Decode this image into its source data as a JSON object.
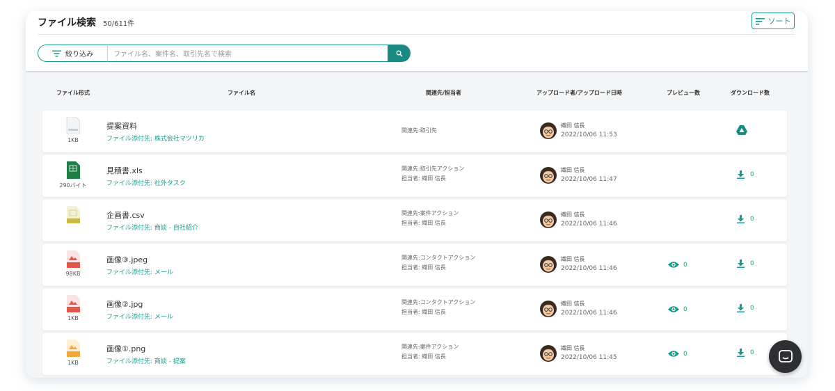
{
  "header": {
    "title": "ファイル検索",
    "count": "50/611件",
    "sort_label": "ソート"
  },
  "search": {
    "filter_label": "絞り込み",
    "placeholder": "ファイル名、案件名、取引先名で検索"
  },
  "columns": {
    "type": "ファイル形式",
    "name": "ファイル名",
    "related": "関連先/担当者",
    "uploader": "アップロード者/アップロード日時",
    "preview": "プレビュー数",
    "download": "ダウンロード数"
  },
  "colors": {
    "accent": "#1a9a8c",
    "xls": "#1e7e45",
    "csv": "#c9b94a",
    "jpeg": "#e2564a",
    "png": "#f2a93b"
  },
  "rows": [
    {
      "icon": "document-icon",
      "size": "1KB",
      "name": "提案資料",
      "attach": "ファイル添付先: 株式会社マツリカ",
      "related": "関連先:取引先",
      "assignee": "",
      "uploader": "織田 信長",
      "date": "2022/10/06 11:53",
      "preview": "",
      "download": "",
      "download_icon": "google-drive-icon"
    },
    {
      "icon": "xls-file-icon",
      "size": "290バイト",
      "name": "見積書.xls",
      "attach": "ファイル添付先: 社外タスク",
      "related": "関連先:取引先アクション",
      "assignee": "担当者: 織田 信長",
      "uploader": "織田 信長",
      "date": "2022/10/06 11:47",
      "preview": "",
      "download": "0",
      "download_icon": "download-icon"
    },
    {
      "icon": "csv-file-icon",
      "size": "",
      "name": "企画書.csv",
      "attach": "ファイル添付先: 商談 - 自社紹介",
      "related": "関連先:案件アクション",
      "assignee": "担当者: 織田 信長",
      "uploader": "織田 信長",
      "date": "2022/10/06 11:46",
      "preview": "",
      "download": "0",
      "download_icon": "download-icon"
    },
    {
      "icon": "jpeg-file-icon",
      "size": "98KB",
      "name": "画像③.jpeg",
      "attach": "ファイル添付先: メール",
      "related": "関連先:コンタクトアクション",
      "assignee": "担当者: 織田 信長",
      "uploader": "織田 信長",
      "date": "2022/10/06 11:46",
      "preview": "0",
      "download": "0",
      "download_icon": "download-icon"
    },
    {
      "icon": "jpg-file-icon",
      "size": "1KB",
      "name": "画像②.jpg",
      "attach": "ファイル添付先: メール",
      "related": "関連先:コンタクトアクション",
      "assignee": "担当者: 織田 信長",
      "uploader": "織田 信長",
      "date": "2022/10/06 11:46",
      "preview": "0",
      "download": "0",
      "download_icon": "download-icon"
    },
    {
      "icon": "png-file-icon",
      "size": "1KB",
      "name": "画像①.png",
      "attach": "ファイル添付先: 商談 - 提案",
      "related": "関連先:案件アクション",
      "assignee": "担当者: 織田 信長",
      "uploader": "織田 信長",
      "date": "2022/10/06 11:45",
      "preview": "0",
      "download": "0",
      "download_icon": "download-icon"
    }
  ]
}
